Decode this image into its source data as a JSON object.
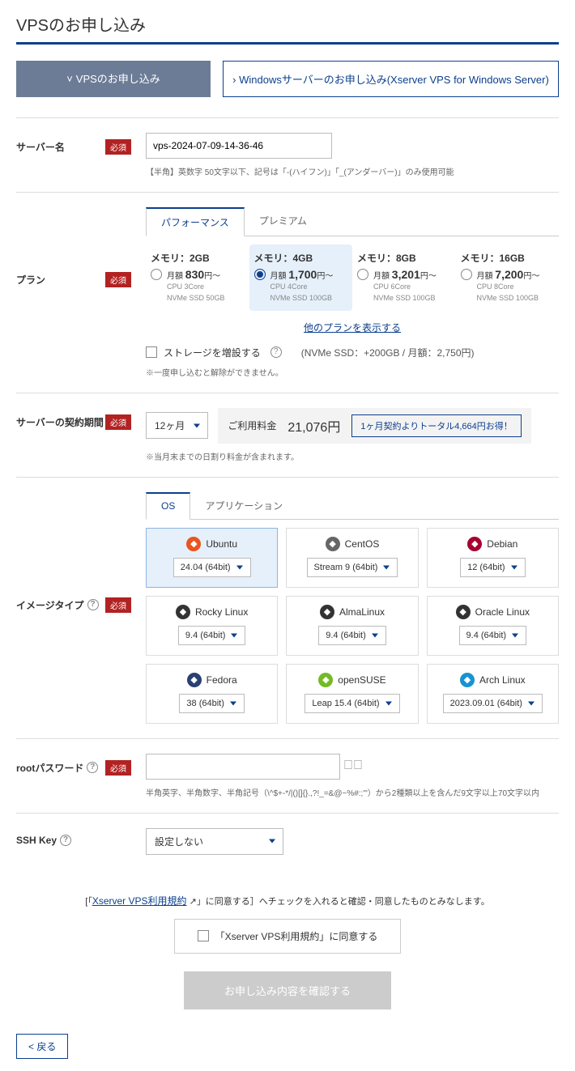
{
  "page_title": "VPSのお申し込み",
  "main_tabs": {
    "active": "VPSのお申し込み",
    "inactive": "Windowsサーバーのお申し込み(Xserver VPS for Windows Server)"
  },
  "server_name": {
    "label": "サーバー名",
    "required": "必須",
    "value": "vps-2024-07-09-14-36-46",
    "hint": "【半角】英数字 50文字以下、記号は「-(ハイフン)」「_(アンダーバー)」のみ使用可能"
  },
  "plan": {
    "label": "プラン",
    "required": "必須",
    "subtabs": {
      "perf": "パフォーマンス",
      "premium": "プレミアム"
    },
    "options": [
      {
        "title": "メモリ：2GB",
        "price_label": "月額",
        "price": "830",
        "suffix": "円～",
        "cpu": "CPU 3Core",
        "ssd": "NVMe SSD 50GB",
        "selected": false
      },
      {
        "title": "メモリ：4GB",
        "price_label": "月額",
        "price": "1,700",
        "suffix": "円～",
        "cpu": "CPU 4Core",
        "ssd": "NVMe SSD 100GB",
        "selected": true
      },
      {
        "title": "メモリ：8GB",
        "price_label": "月額",
        "price": "3,201",
        "suffix": "円～",
        "cpu": "CPU 6Core",
        "ssd": "NVMe SSD 100GB",
        "selected": false
      },
      {
        "title": "メモリ：16GB",
        "price_label": "月額",
        "price": "7,200",
        "suffix": "円～",
        "cpu": "CPU 8Core",
        "ssd": "NVMe SSD 100GB",
        "selected": false
      }
    ],
    "more_link": "他のプランを表示する",
    "storage_checkbox": "ストレージを増設する",
    "storage_note": "(NVMe SSD：+200GB / 月額：2,750円)",
    "caution": "※一度申し込むと解除ができません。"
  },
  "term": {
    "label": "サーバーの契約期間",
    "required": "必須",
    "value": "12ヶ月",
    "fee_label": "ご利用料金",
    "fee": "21,076円",
    "savings": "1ヶ月契約よりトータル4,664円お得！",
    "note": "※当月末までの日割り料金が含まれます。"
  },
  "image": {
    "label": "イメージタイプ",
    "required": "必須",
    "subtabs": {
      "os": "OS",
      "app": "アプリケーション"
    },
    "items": [
      {
        "name": "Ubuntu",
        "ver": "24.04 (64bit)",
        "selected": true,
        "color": "#e95420"
      },
      {
        "name": "CentOS",
        "ver": "Stream 9 (64bit)",
        "selected": false,
        "color": "#666"
      },
      {
        "name": "Debian",
        "ver": "12 (64bit)",
        "selected": false,
        "color": "#a80030"
      },
      {
        "name": "Rocky Linux",
        "ver": "9.4 (64bit)",
        "selected": false,
        "color": "#333"
      },
      {
        "name": "AlmaLinux",
        "ver": "9.4 (64bit)",
        "selected": false,
        "color": "#333"
      },
      {
        "name": "Oracle Linux",
        "ver": "9.4 (64bit)",
        "selected": false,
        "color": "#333"
      },
      {
        "name": "Fedora",
        "ver": "38 (64bit)",
        "selected": false,
        "color": "#294172"
      },
      {
        "name": "openSUSE",
        "ver": "Leap 15.4 (64bit)",
        "selected": false,
        "color": "#73ba25"
      },
      {
        "name": "Arch Linux",
        "ver": "2023.09.01 (64bit)",
        "selected": false,
        "color": "#1793d1"
      }
    ]
  },
  "root_pw": {
    "label": "rootパスワード",
    "required": "必須",
    "hint": "半角英字、半角数字、半角記号（\\^$+-*/|()[]{}.,?!_=&@~%#:;'\"）から2種類以上を含んだ9文字以上70文字以内"
  },
  "ssh": {
    "label": "SSH Key",
    "value": "設定しない"
  },
  "terms": {
    "pretext_a": "[「",
    "link": "Xserver VPS利用規約",
    "pretext_b": "」に同意する］へチェックを入れると確認・同意したものとみなします。",
    "checkbox_label": "「Xserver VPS利用規約」に同意する"
  },
  "submit": "お申し込み内容を確認する",
  "back": "< 戻る"
}
